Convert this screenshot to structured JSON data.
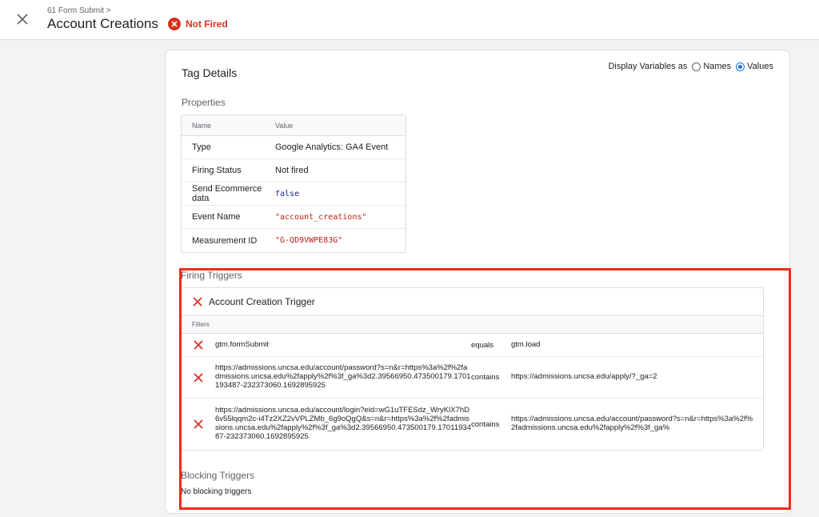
{
  "header": {
    "breadcrumb": "61 Form Submit >",
    "title": "Account Creations",
    "status": "Not Fired"
  },
  "card": {
    "title": "Tag Details",
    "display_vars_label": "Display Variables as",
    "option_names": "Names",
    "option_values": "Values",
    "selected_option": "Values"
  },
  "properties": {
    "label": "Properties",
    "col_name": "Name",
    "col_value": "Value",
    "rows": [
      {
        "name": "Type",
        "value": "Google Analytics: GA4 Event"
      },
      {
        "name": "Firing Status",
        "value": "Not fired"
      },
      {
        "name": "Send Ecommerce data",
        "value": "false"
      },
      {
        "name": "Event Name",
        "value": "\"account_creations\""
      },
      {
        "name": "Measurement ID",
        "value": "\"G-QD9VWPE83G\""
      }
    ]
  },
  "firing_triggers": {
    "label": "Firing Triggers",
    "trigger_name": "Account Creation Trigger",
    "filters_label": "Filters",
    "filters": [
      {
        "variable": "gtm.formSubmit",
        "operator": "equals",
        "value": "gtm.load"
      },
      {
        "variable": "https://admissions.uncsa.edu/account/password?s=n&r=https%3a%2f%2fadmissions.uncsa.edu%2fapply%2f%3f_ga%3d2.39566950.473500179.1701193487-232373060.1692895925",
        "operator": "contains",
        "value": "https://admissions.uncsa.edu/apply/?_ga=2"
      },
      {
        "variable": "https://admissions.uncsa.edu/account/login?eid=wG1uTFESdz_WryKlX7hD6v55lqqm2c-i4Tz2XZ2vVPLZMb_6g9oQgQ&s=n&r=https%3a%2f%2fadmissions.uncsa.edu%2fapply%2f%3f_ga%3d2.39566950.473500179.1701193487-232373060.1692895925",
        "operator": "contains",
        "value": "https://admissions.uncsa.edu/account/password?s=n&r=https%3a%2f%2fadmissions.uncsa.edu%2fapply%2f%3f_ga%"
      }
    ]
  },
  "blocking_triggers": {
    "label": "Blocking Triggers",
    "empty_text": "No blocking triggers"
  },
  "colors": {
    "error_red": "#d93025",
    "highlight_red": "#f02b1d",
    "accent_blue": "#1a73e8"
  }
}
